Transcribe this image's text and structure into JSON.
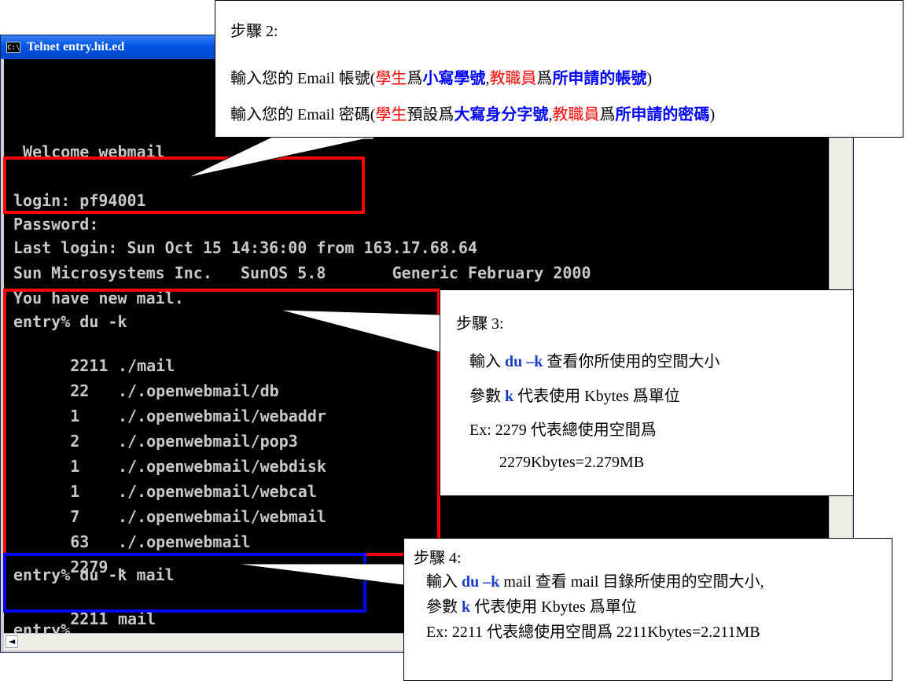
{
  "window": {
    "icon_text": "C:\\",
    "title": "Telnet entry.hit.ed"
  },
  "terminal": {
    "lines": [
      {
        "text": " Welcome webmail"
      },
      {
        "text": ""
      },
      {
        "text": "login: pf94001"
      },
      {
        "text": "Password:"
      },
      {
        "text": "Last login: Sun Oct 15 14:36:00 from 163.17.68.64"
      },
      {
        "text": "Sun Microsystems Inc.   SunOS 5.8       Generic February 2000"
      },
      {
        "text": "You have new mail."
      },
      {
        "text": "entry% du -k"
      },
      {
        "size": "2211",
        "path": "./mail"
      },
      {
        "size": "22",
        "path": "./.openwebmail/db"
      },
      {
        "size": "1",
        "path": "./.openwebmail/webaddr"
      },
      {
        "size": "2",
        "path": "./.openwebmail/pop3"
      },
      {
        "size": "1",
        "path": "./.openwebmail/webdisk"
      },
      {
        "size": "1",
        "path": "./.openwebmail/webcal"
      },
      {
        "size": "7",
        "path": "./.openwebmail/webmail"
      },
      {
        "size": "63",
        "path": "./.openwebmail"
      },
      {
        "size": "2279",
        "path": "."
      },
      {
        "text": "entry% du -k mail"
      },
      {
        "size": "2211",
        "path": "mail"
      },
      {
        "text": "entry%"
      }
    ]
  },
  "hscroll": {
    "left_arrow": "◄"
  },
  "step2": {
    "heading": "步驟 2:",
    "line1": {
      "prefix": "輸入您的 Email 帳號(",
      "student": "學生",
      "is1": "爲",
      "student_value": "小寫學號",
      "comma": ",",
      "staff": "教職員",
      "is2": "爲",
      "staff_value": "所申請的帳號",
      "close": ")"
    },
    "line2": {
      "prefix": "輸入您的 Email 密碼(",
      "student": "學生",
      "is1": "預設爲",
      "student_value": "大寫身分字號",
      "comma": ",",
      "staff": "教職員",
      "is2": "爲",
      "staff_value": "所申請的密碼",
      "close": ")"
    }
  },
  "step3": {
    "heading": "步驟 3:",
    "line1": {
      "pre": "輸入 ",
      "cmd": "du –k",
      "post": "  查看你所使用的空間大小"
    },
    "line2": {
      "pre": "參數 ",
      "param": "k",
      "post": " 代表使用 Kbytes 爲單位"
    },
    "line3": "Ex: 2279 代表總使用空間爲",
    "line4": "2279Kbytes=2.279MB"
  },
  "step4": {
    "heading": "步驟 4:",
    "line1": {
      "pre": "輸入 ",
      "cmd": "du –k",
      "post": " mail 查看 mail 目錄所使用的空間大小,"
    },
    "line2": {
      "pre": "參數 ",
      "param": "k",
      "post": " 代表使用 Kbytes 爲單位"
    },
    "line3": "Ex: 2211 代表總使用空間爲 2211Kbytes=2.211MB"
  },
  "colors": {
    "highlight_red": "#ff0000",
    "highlight_blue": "#0000ff",
    "console_bg": "#000000",
    "console_text": "#c8c8c8"
  }
}
